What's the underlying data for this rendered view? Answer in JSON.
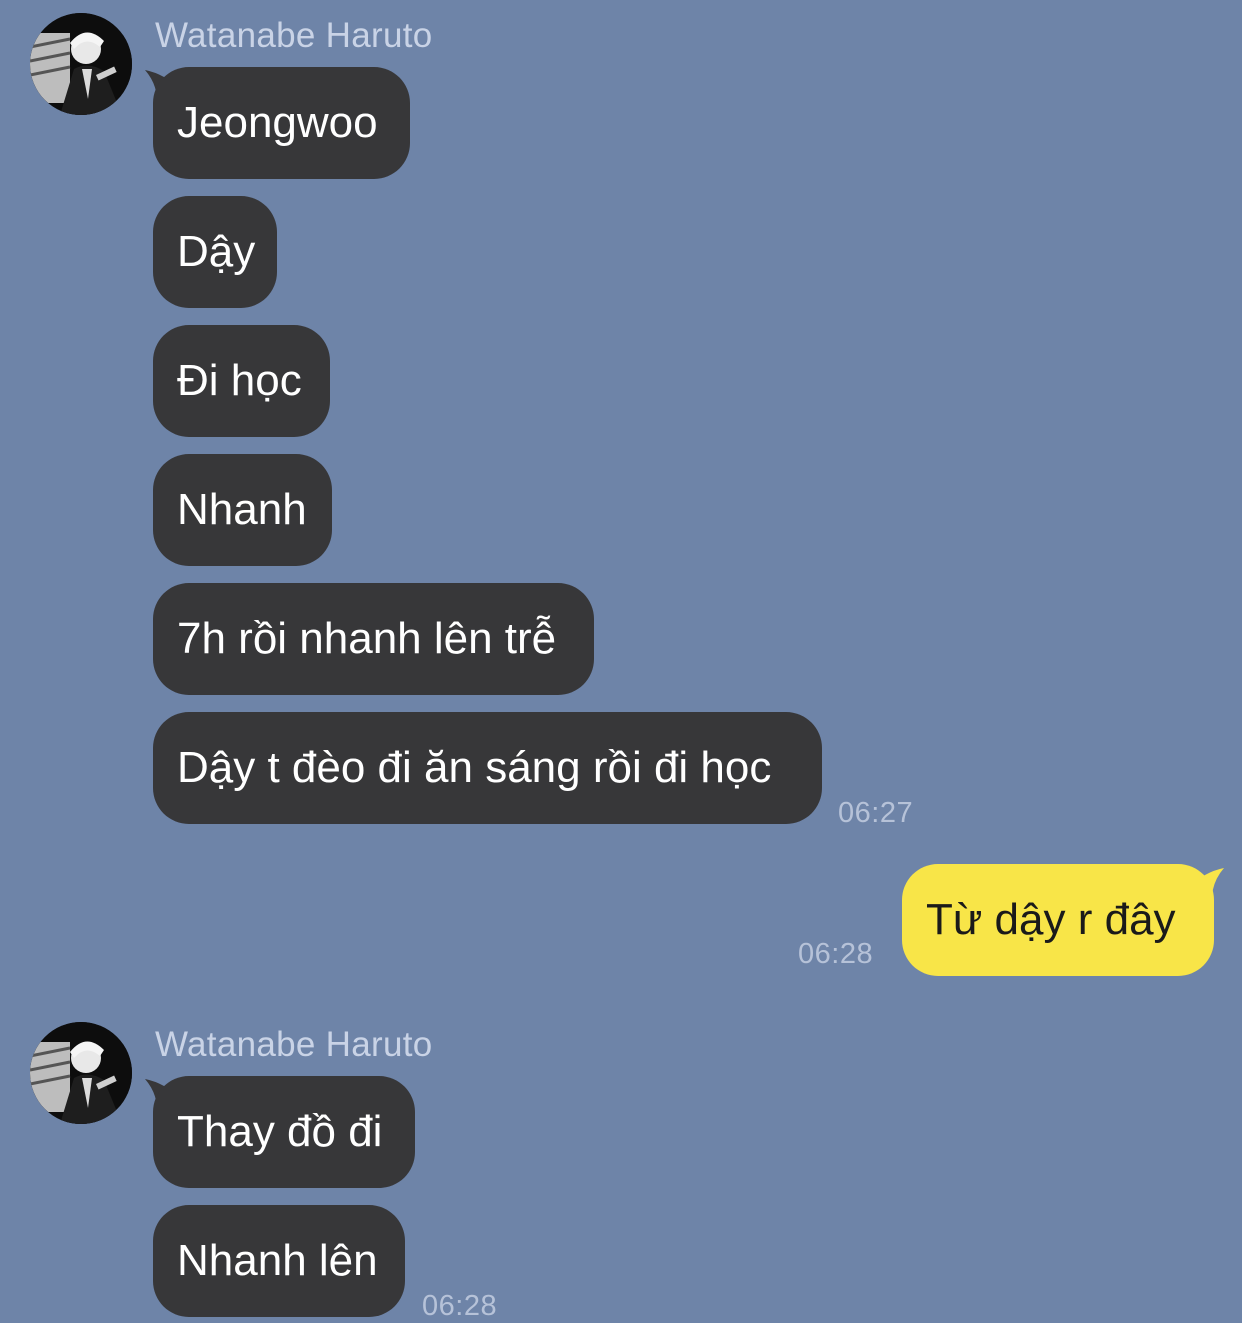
{
  "groups": [
    {
      "sender": "Watanabe Haruto",
      "avatar_icon": "profile-photo",
      "messages": [
        "Jeongwoo",
        "Dậy",
        "Đi học",
        "Nhanh",
        "7h rồi nhanh lên trễ",
        "Dậy t đèo đi ăn sáng rồi đi học"
      ],
      "time": "06:27"
    },
    {
      "outgoing": true,
      "messages": [
        "Từ dậy r đây"
      ],
      "time": "06:28"
    },
    {
      "sender": "Watanabe Haruto",
      "avatar_icon": "profile-photo",
      "messages": [
        "Thay đồ đi",
        "Nhanh lên"
      ],
      "time": "06:28"
    }
  ],
  "colors": {
    "background": "#6e84a8",
    "incoming_bubble": "#373739",
    "outgoing_bubble": "#f8e548"
  }
}
